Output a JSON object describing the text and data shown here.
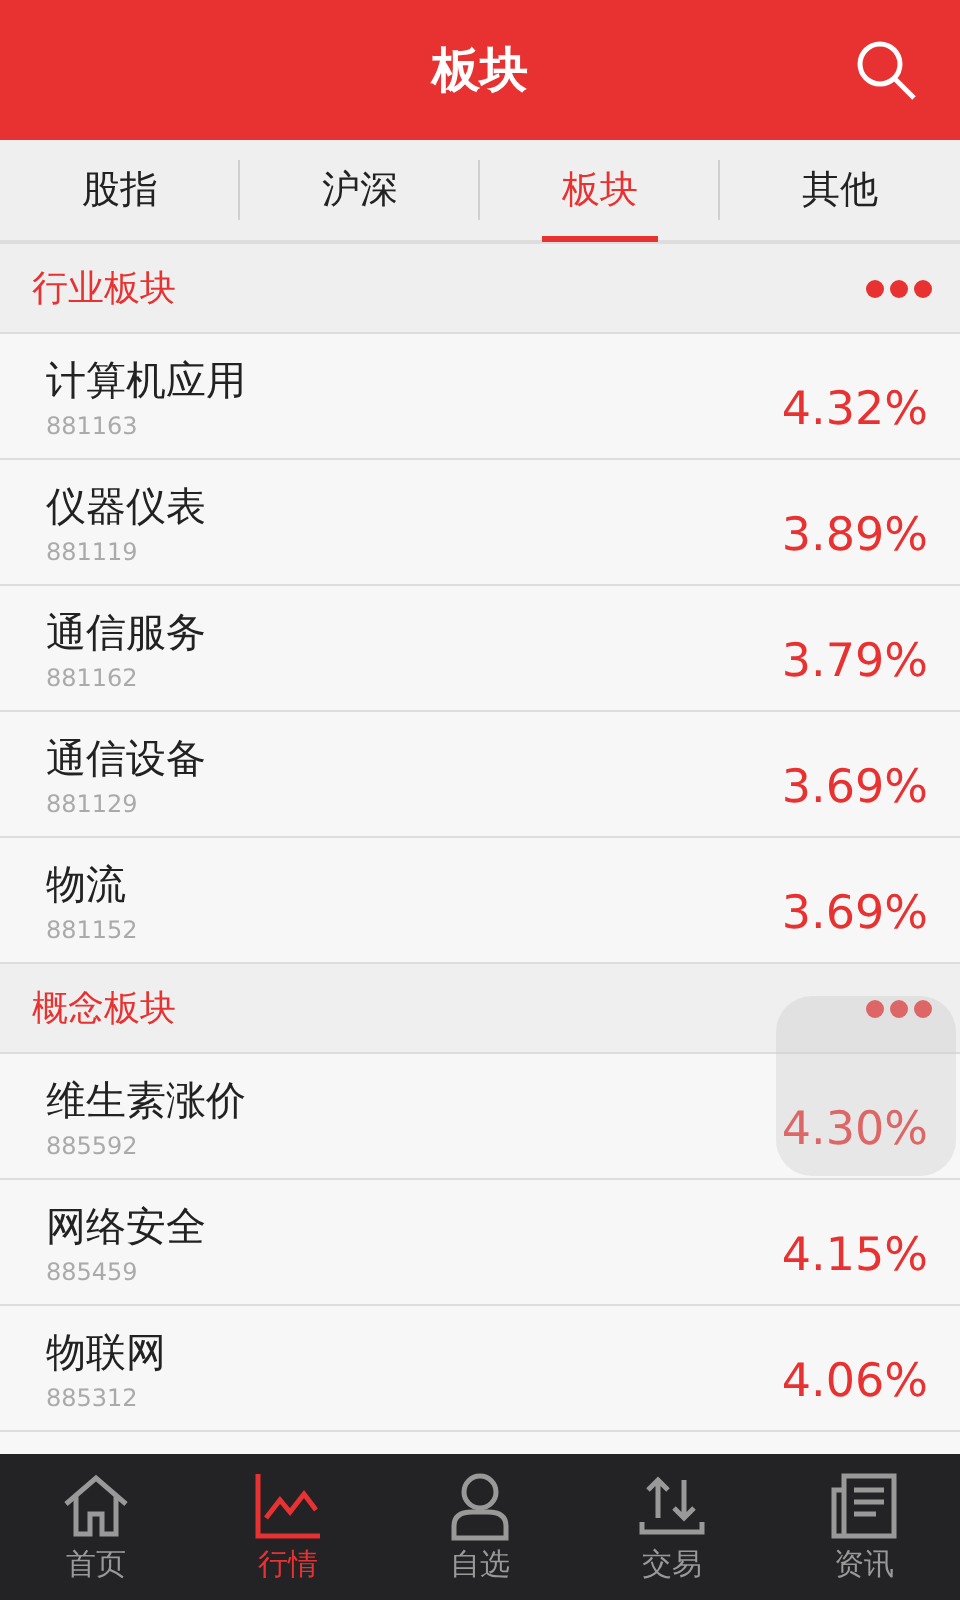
{
  "header": {
    "title": "板块"
  },
  "tabs": [
    {
      "label": "股指",
      "selected": false
    },
    {
      "label": "沪深",
      "selected": false
    },
    {
      "label": "板块",
      "selected": true
    },
    {
      "label": "其他",
      "selected": false
    }
  ],
  "sections": [
    {
      "title": "行业板块",
      "rows": [
        {
          "name": "计算机应用",
          "code": "881163",
          "change": "4.32%"
        },
        {
          "name": "仪器仪表",
          "code": "881119",
          "change": "3.89%"
        },
        {
          "name": "通信服务",
          "code": "881162",
          "change": "3.79%"
        },
        {
          "name": "通信设备",
          "code": "881129",
          "change": "3.69%"
        },
        {
          "name": "物流",
          "code": "881152",
          "change": "3.69%"
        }
      ]
    },
    {
      "title": "概念板块",
      "rows": [
        {
          "name": "维生素涨价",
          "code": "885592",
          "change": "4.30%"
        },
        {
          "name": "网络安全",
          "code": "885459",
          "change": "4.15%"
        },
        {
          "name": "物联网",
          "code": "885312",
          "change": "4.06%"
        }
      ]
    }
  ],
  "nav": [
    {
      "kind": "home",
      "label": "首页",
      "selected": false
    },
    {
      "kind": "chart",
      "label": "行情",
      "selected": true
    },
    {
      "kind": "person",
      "label": "自选",
      "selected": false
    },
    {
      "kind": "trade",
      "label": "交易",
      "selected": false
    },
    {
      "kind": "news",
      "label": "资讯",
      "selected": false
    }
  ]
}
